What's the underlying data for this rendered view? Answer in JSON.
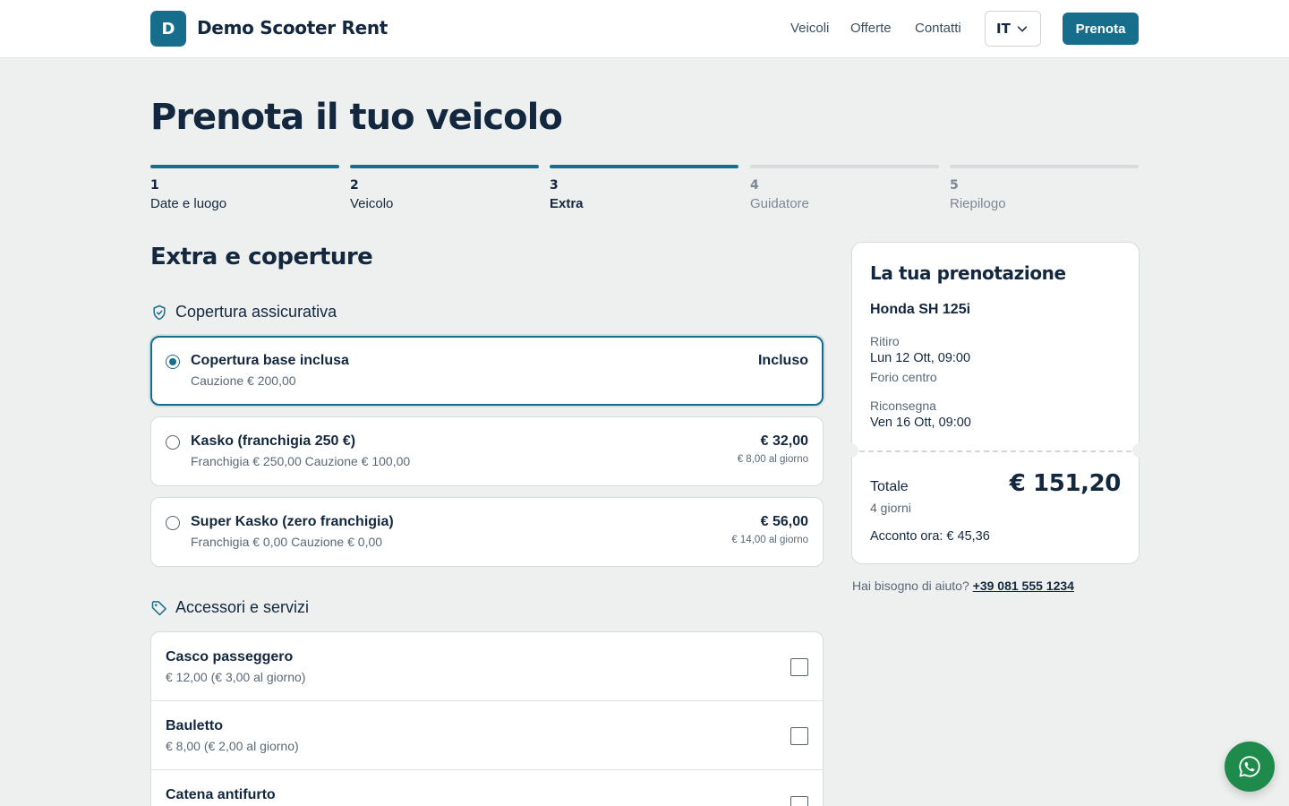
{
  "header": {
    "logo_letter": "D",
    "brand": "Demo Scooter Rent",
    "nav": [
      "Veicoli",
      "Offerte",
      "Contatti"
    ],
    "language": "IT",
    "cta": "Prenota"
  },
  "page_title": "Prenota il tuo veicolo",
  "steps": [
    {
      "num": "1",
      "label": "Date e luogo",
      "state": "done"
    },
    {
      "num": "2",
      "label": "Veicolo",
      "state": "done"
    },
    {
      "num": "3",
      "label": "Extra",
      "state": "current"
    },
    {
      "num": "4",
      "label": "Guidatore",
      "state": "todo"
    },
    {
      "num": "5",
      "label": "Riepilogo",
      "state": "todo"
    }
  ],
  "section_title": "Extra e coperture",
  "insurance": {
    "heading": "Copertura assicurativa",
    "options": [
      {
        "name": "Copertura base inclusa",
        "detail": "Cauzione € 200,00",
        "price": "Incluso",
        "per_day": "",
        "selected": true
      },
      {
        "name": "Kasko (franchigia 250 €)",
        "detail": "Franchigia € 250,00 Cauzione € 100,00",
        "price": "€ 32,00",
        "per_day": "€ 8,00 al giorno",
        "selected": false
      },
      {
        "name": "Super Kasko (zero franchigia)",
        "detail": "Franchigia € 0,00 Cauzione € 0,00",
        "price": "€ 56,00",
        "per_day": "€ 14,00 al giorno",
        "selected": false
      }
    ]
  },
  "accessories": {
    "heading": "Accessori e servizi",
    "items": [
      {
        "name": "Casco passeggero",
        "detail": "€ 12,00 (€ 3,00 al giorno)",
        "checked": false
      },
      {
        "name": "Bauletto",
        "detail": "€ 8,00 (€ 2,00 al giorno)",
        "checked": false
      },
      {
        "name": "Catena antifurto",
        "detail": "",
        "checked": false
      }
    ]
  },
  "summary": {
    "title": "La tua prenotazione",
    "vehicle": "Honda SH 125i",
    "pickup_label": "Ritiro",
    "pickup_date": "Lun 12 Ott, 09:00",
    "pickup_place": "Forio centro",
    "return_label": "Riconsegna",
    "return_date": "Ven 16 Ott, 09:00",
    "total_label": "Totale",
    "total_value": "€ 151,20",
    "days": "4 giorni",
    "deposit": "Acconto ora: € 45,36"
  },
  "help": {
    "text": "Hai bisogno di aiuto?",
    "phone": "+39 081 555 1234"
  },
  "colors": {
    "primary": "#176e8c",
    "text": "#13283f",
    "background": "#eef0ef",
    "whatsapp": "#1e8a4c"
  },
  "icons": [
    "shield-check-icon",
    "tag-icon",
    "chevron-down-icon",
    "whatsapp-icon"
  ]
}
